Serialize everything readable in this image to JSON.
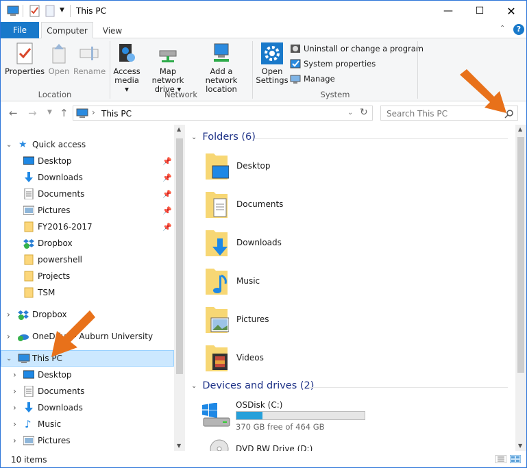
{
  "window": {
    "title": "This PC"
  },
  "ribbon": {
    "tabs": [
      "File",
      "Computer",
      "View"
    ],
    "buttons": {
      "properties": "Properties",
      "open": "Open",
      "rename": "Rename",
      "access_media": [
        "Access",
        "media ▾"
      ],
      "map_drive": [
        "Map network",
        "drive ▾"
      ],
      "add_location": [
        "Add a network",
        "location"
      ],
      "open_settings": [
        "Open",
        "Settings"
      ],
      "uninstall": "Uninstall or change a program",
      "system_properties": "System properties",
      "manage": "Manage"
    },
    "groups": {
      "location": "Location",
      "network": "Network",
      "system": "System"
    }
  },
  "address": {
    "path": "This PC",
    "search_placeholder": "Search This PC"
  },
  "tree": {
    "quick_access": "Quick access",
    "qa_items": [
      "Desktop",
      "Downloads",
      "Documents",
      "Pictures",
      "FY2016-2017",
      "Dropbox",
      "powershell",
      "Projects",
      "TSM"
    ],
    "dropbox": "Dropbox",
    "onedrive": "OneDrive - Auburn University",
    "this_pc": "This PC",
    "pc_items": [
      "Desktop",
      "Documents",
      "Downloads",
      "Music",
      "Pictures"
    ]
  },
  "main": {
    "folders_header": "Folders (6)",
    "folders": [
      "Desktop",
      "Documents",
      "Downloads",
      "Music",
      "Pictures",
      "Videos"
    ],
    "devices_header": "Devices and drives (2)",
    "drive": {
      "name": "OSDisk (C:)",
      "free_text": "370 GB free of 464 GB",
      "used_fraction": 0.203
    },
    "drive2": "DVD RW Drive (D:)"
  },
  "status": {
    "items": "10 items"
  },
  "colors": {
    "accent": "#1979ca",
    "arrow": "#e8711a",
    "selection": "#cce8ff"
  }
}
